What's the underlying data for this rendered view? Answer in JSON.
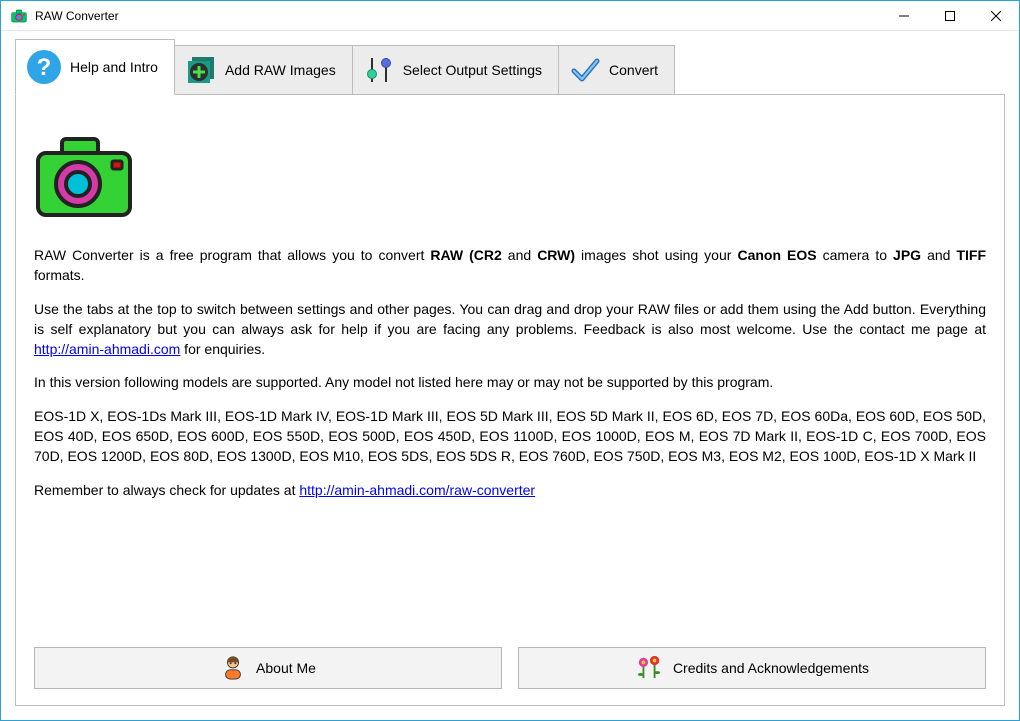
{
  "window": {
    "title": "RAW Converter"
  },
  "tabs": {
    "help": {
      "label": "Help and Intro"
    },
    "add": {
      "label": "Add RAW Images"
    },
    "output": {
      "label": "Select Output Settings"
    },
    "convert": {
      "label": "Convert"
    }
  },
  "intro": {
    "p1_a": "RAW Converter is a free program that allows you to convert ",
    "p1_b": "RAW (CR2",
    "p1_c": " and ",
    "p1_d": "CRW)",
    "p1_e": " images shot using your ",
    "p1_f": "Canon EOS",
    "p1_g": " camera to ",
    "p1_h": "JPG",
    "p1_i": " and ",
    "p1_j": "TIFF",
    "p1_k": " formats.",
    "p2_a": "Use the tabs at the top to switch between settings and other pages. You can drag and drop your RAW files or add them using the Add button. Everything is self explanatory but you can always ask for help if you are facing any problems. Feedback is also most welcome. Use the contact me page at ",
    "p2_link": "http://amin-ahmadi.com",
    "p2_b": " for enquiries.",
    "p3": "In this version following models are supported. Any model not listed here may or may not be supported by this program.",
    "models": "EOS-1D X, EOS-1Ds Mark III, EOS-1D Mark IV, EOS-1D Mark III, EOS 5D Mark III, EOS 5D Mark II, EOS 6D, EOS 7D, EOS 60Da, EOS 60D, EOS 50D, EOS 40D, EOS 650D, EOS 600D, EOS 550D, EOS 500D, EOS 450D, EOS 1100D, EOS 1000D, EOS M, EOS 7D Mark II, EOS-1D C, EOS 700D, EOS 70D, EOS 1200D, EOS 80D, EOS 1300D, EOS M10, EOS 5DS, EOS 5DS R, EOS 760D, EOS 750D, EOS M3, EOS M2, EOS 100D, EOS-1D X Mark II",
    "p5_a": "Remember to always check for updates at ",
    "p5_link": "http://amin-ahmadi.com/raw-converter"
  },
  "buttons": {
    "about": "About Me",
    "credits": "Credits and Acknowledgements"
  }
}
